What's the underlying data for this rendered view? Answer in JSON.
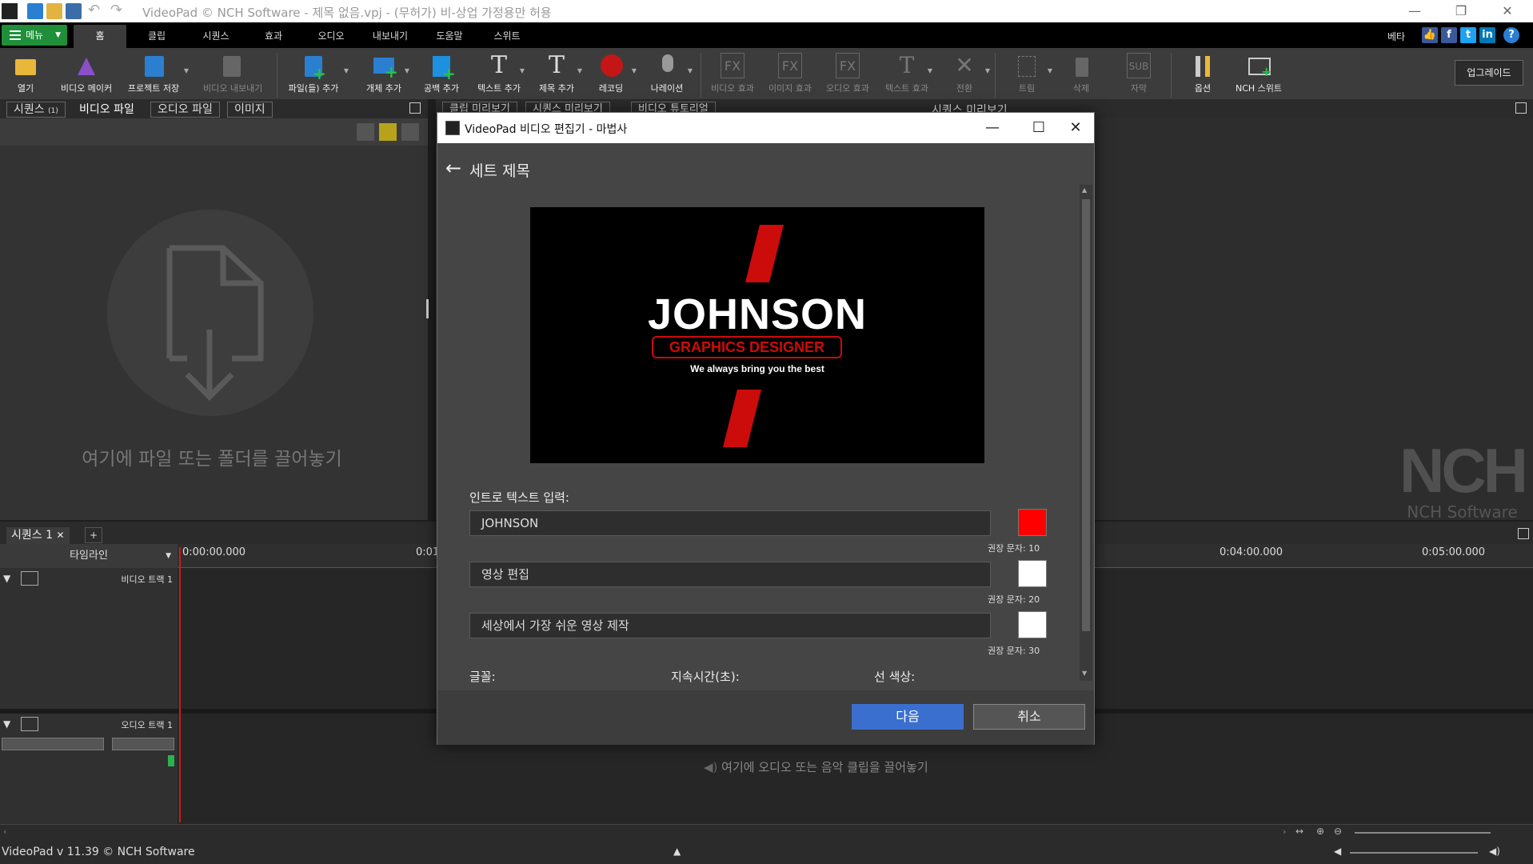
{
  "window": {
    "title": "VideoPad © NCH Software - 제목 없음.vpj - (무허가) 비-상업 가정용만 허용",
    "controls": {
      "minimize": "—",
      "restore": "❐",
      "close": "✕"
    }
  },
  "tabstrip": {
    "menu_label": "메뉴",
    "tabs": [
      "홈",
      "클립",
      "시퀀스",
      "효과",
      "오디오",
      "내보내기",
      "도움말",
      "스위트"
    ],
    "active_tab": "홈",
    "right_label": "베타"
  },
  "toolbar": {
    "tools": [
      {
        "label": "열기",
        "icon": "folder-icon"
      },
      {
        "label": "비디오 메이커",
        "icon": "wizard-icon"
      },
      {
        "label": "프로젝트 저장",
        "icon": "save-icon"
      },
      {
        "label": "비디오 내보내기",
        "icon": "export-icon"
      },
      {
        "label": "파일(들) 추가",
        "icon": "add-file-icon"
      },
      {
        "label": "개체 추가",
        "icon": "add-object-icon"
      },
      {
        "label": "공백 추가",
        "icon": "add-blank-icon"
      },
      {
        "label": "텍스트 추가",
        "icon": "add-text-icon"
      },
      {
        "label": "제목 추가",
        "icon": "add-title-icon"
      },
      {
        "label": "레코딩",
        "icon": "record-icon"
      },
      {
        "label": "나레이션",
        "icon": "microphone-icon"
      },
      {
        "label": "비디오 효과",
        "icon": "video-fx-icon"
      },
      {
        "label": "이미지 효과",
        "icon": "image-fx-icon"
      },
      {
        "label": "오디오 효과",
        "icon": "audio-fx-icon"
      },
      {
        "label": "텍스트 효과",
        "icon": "text-fx-icon"
      },
      {
        "label": "전환",
        "icon": "transition-icon"
      },
      {
        "label": "트림",
        "icon": "trim-icon"
      },
      {
        "label": "삭제",
        "icon": "trash-icon"
      },
      {
        "label": "자막",
        "icon": "subtitle-icon"
      },
      {
        "label": "옵션",
        "icon": "options-icon"
      },
      {
        "label": "NCH 스위트",
        "icon": "suite-icon"
      }
    ],
    "upgrade_label": "업그레이드"
  },
  "media": {
    "tabs": [
      "시퀀스",
      "비디오 파일",
      "오디오 파일",
      "이미지"
    ],
    "active_tab": "비디오 파일",
    "sequence_badge": "(1)",
    "drop_text": "여기에 파일 또는 폴더를 끌어놓기"
  },
  "preview": {
    "tabs": [
      "클립 미리보기",
      "시퀀스 미리보기",
      "비디오 튜토리얼"
    ],
    "sequence_preview_label": "시퀀스 미리보기",
    "logo_text": "NCH",
    "logo_sub": "NCH Software"
  },
  "sequence": {
    "tab_label": "시퀀스 1",
    "add_label": "+",
    "timeline_label": "타임라인",
    "ruler": [
      "0:00:00.000",
      "0:01",
      "0:04:00.000",
      "0:05:00.000"
    ],
    "video_track": "비디오 트랙 1",
    "audio_track": "오디오 트랙 1",
    "audio_drop": "여기에 오디오 또는 음악 클립을 끌어놓기"
  },
  "status": {
    "version": "VideoPad v 11.39 © NCH Software"
  },
  "dialog": {
    "title": "VideoPad 비디오 편집기 - 마법사",
    "heading": "세트 제목",
    "image": {
      "main_text": "JOHNSON",
      "sub_text": "GRAPHICS DESIGNER",
      "tagline": "We always bring you the best"
    },
    "intro_label": "인트로 텍스트 입력:",
    "fields": [
      {
        "value": "JOHNSON",
        "color": "#ff0000",
        "hint": "권장 문자: 10"
      },
      {
        "value": "영상 편집",
        "color": "#ffffff",
        "hint": "권장 문자: 20"
      },
      {
        "value": "세상에서 가장 쉬운 영상 제작",
        "color": "#ffffff",
        "hint": "권장 문자: 30"
      }
    ],
    "font_label": "글꼴:",
    "duration_label": "지속시간(초):",
    "line_color_label": "선 색상:",
    "next_label": "다음",
    "cancel_label": "취소"
  },
  "colors": {
    "accent_green": "#1f8f3a",
    "next_blue": "#3a6fcf",
    "brand_red": "#cc0b0b"
  }
}
